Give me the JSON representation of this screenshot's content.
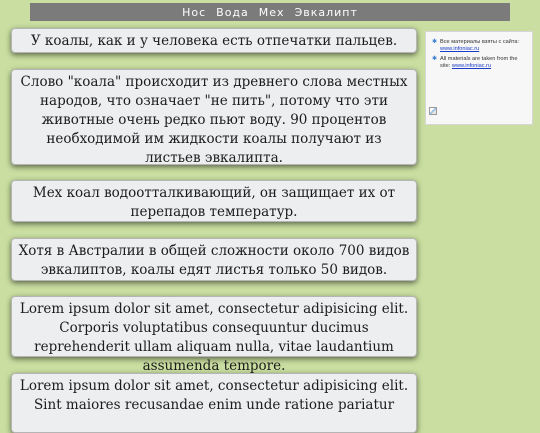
{
  "nav": {
    "links": [
      "Нос",
      "Вода",
      "Мех",
      "Эвкалипт"
    ]
  },
  "cards": [
    "У коалы, как и у человека есть отпечатки пальцев.",
    "Слово \"коала\" происходит из древнего слова местных народов, что означает \"не пить\", потому что эти животные очень редко пьют воду. 90 процентов необходимой им жидкости коалы получают из листьев эвкалипта.",
    "Мех коал водоотталкивающий, он защищает их от перепадов температур.",
    "Хотя в Австралии в общей сложности около 700 видов эвкалиптов, коалы едят листья только 50 видов.",
    "Lorem ipsum dolor sit amet, consectetur adipisicing elit. Corporis voluptatibus consequuntur ducimus reprehenderit ullam aliquam nulla, vitae laudantium assumenda tempore.",
    "Lorem ipsum dolor sit amet, consectetur adipisicing elit. Sint maiores recusandae enim unde ratione pariatur"
  ],
  "widget": {
    "line1_text": "Все материалы взяты с сайта:",
    "line1_link": "www.infoniac.ru",
    "line2_text": "All materials are taken from the site:",
    "line2_link": "www.infoniac.ru",
    "icon": "star-icon"
  },
  "colors": {
    "background": "#c9dea0",
    "navbar": "#7b7b7b",
    "card": "#eceef0",
    "link": "#1a3cc8"
  }
}
